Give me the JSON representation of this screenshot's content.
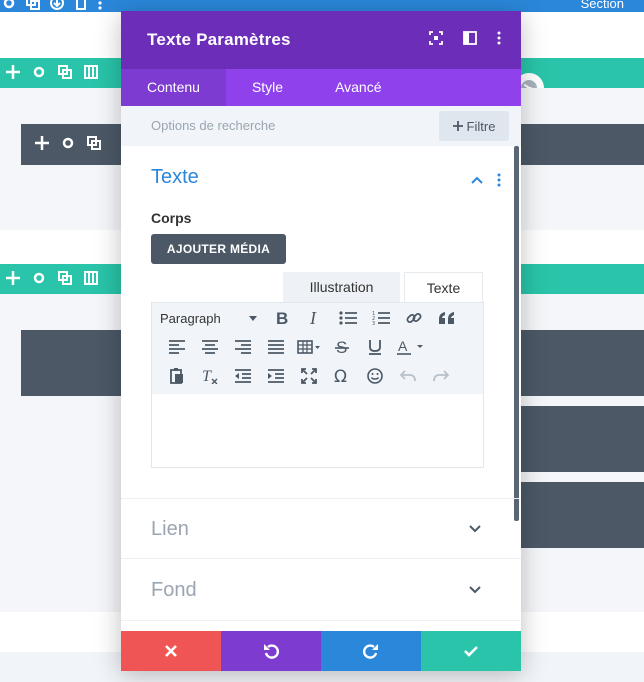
{
  "builder": {
    "section_label": "Section",
    "colors": {
      "section": "#2b87da",
      "row": "#29c4a9",
      "module": "#4c5866"
    }
  },
  "modal": {
    "title": "Texte Paramètres",
    "header_icons": [
      "fullscreen-icon",
      "sidebar-icon",
      "more-vertical-icon"
    ],
    "tabs": [
      {
        "label": "Contenu",
        "active": true
      },
      {
        "label": "Style",
        "active": false
      },
      {
        "label": "Avancé",
        "active": false
      }
    ],
    "search": {
      "placeholder": "Options de recherche"
    },
    "filter_button": {
      "label": "Filtre"
    },
    "sections": {
      "texte": {
        "title": "Texte",
        "expanded": true
      },
      "lien": {
        "title": "Lien",
        "expanded": false
      },
      "fond": {
        "title": "Fond",
        "expanded": false
      }
    },
    "body_field": {
      "label": "Corps",
      "add_media_label": "AJOUTER MÉDIA",
      "editor_tabs": [
        {
          "label": "Illustration",
          "active": true
        },
        {
          "label": "Texte",
          "active": false
        }
      ],
      "paragraph_select": "Paragraph",
      "content": ""
    },
    "footer": {
      "buttons": [
        "close-icon",
        "undo-icon",
        "redo-icon",
        "save-check-icon"
      ],
      "colors": [
        "#ef5555",
        "#7e3bd0",
        "#2b87da",
        "#29c4a9"
      ]
    },
    "colors": {
      "header": "#6c2eb9",
      "tabs": "#8f42ec",
      "accent": "#2b87da"
    }
  }
}
